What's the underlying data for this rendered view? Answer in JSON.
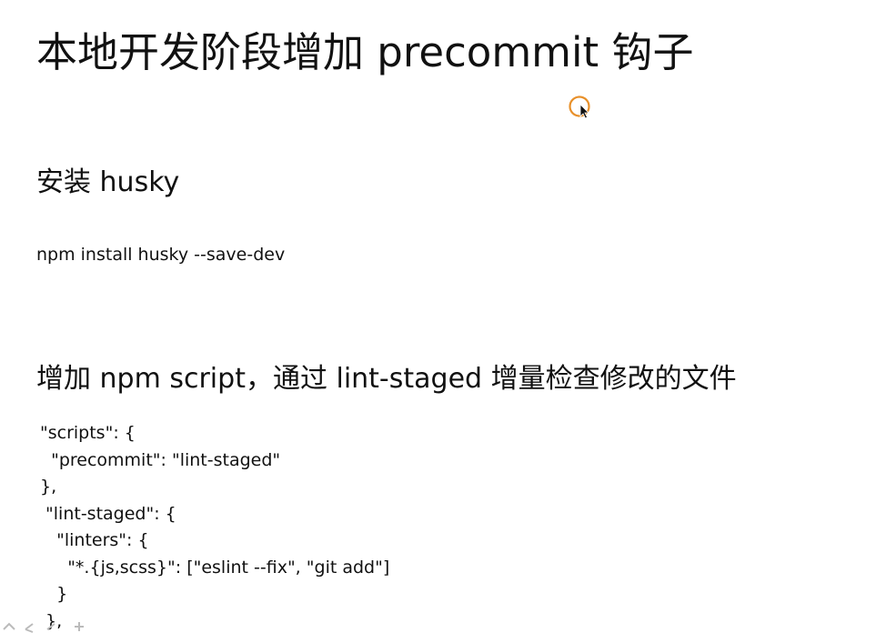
{
  "slide": {
    "title": "本地开发阶段增加 precommit 钩子",
    "section_install": {
      "heading": "安装 husky",
      "command": "npm install husky --save-dev"
    },
    "section_script": {
      "heading": "增加 npm script，通过 lint-staged 增量检查修改的文件",
      "code_lines": [
        "\"scripts\": {",
        "  \"precommit\": \"lint-staged\"",
        "},",
        " \"lint-staged\": {",
        "   \"linters\": {",
        "     \"*.{js,scss}\": [\"eslint --fix\", \"git add\"]",
        "   }",
        " },"
      ]
    }
  },
  "icons": {
    "cursor": "mouse-pointer-with-click-ring-icon"
  },
  "colors": {
    "background": "#ffffff",
    "text": "#111111",
    "cursor_ring": "#e8902a"
  }
}
